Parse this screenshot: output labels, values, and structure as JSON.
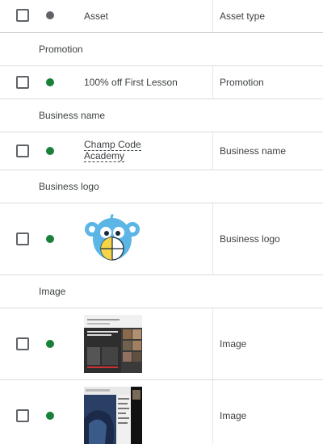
{
  "header": {
    "col_asset": "Asset",
    "col_asset_type": "Asset type",
    "status_color": "#5f6368"
  },
  "groups": [
    {
      "label": "Promotion",
      "rows": [
        {
          "asset": "100% off First Lesson",
          "asset_type": "Promotion",
          "status_color": "#188038"
        }
      ]
    },
    {
      "label": "Business name",
      "rows": [
        {
          "asset_line1": "Champ Code",
          "asset_line2": "Academy",
          "asset_type": "Business name",
          "status_color": "#188038"
        }
      ]
    },
    {
      "label": "Business logo",
      "rows": [
        {
          "asset_icon": "monkey-mouse-logo",
          "asset_type": "Business logo",
          "status_color": "#188038"
        }
      ]
    },
    {
      "label": "Image",
      "rows": [
        {
          "asset_icon": "screenshot-thumbnail",
          "asset_type": "Image",
          "status_color": "#188038"
        },
        {
          "asset_icon": "photo-thumbnail",
          "asset_type": "Image",
          "status_color": "#188038"
        }
      ]
    }
  ],
  "colors": {
    "status_active": "#188038",
    "status_header": "#5f6368",
    "logo_blue": "#5bb6e6",
    "logo_yellow": "#f5d547"
  }
}
